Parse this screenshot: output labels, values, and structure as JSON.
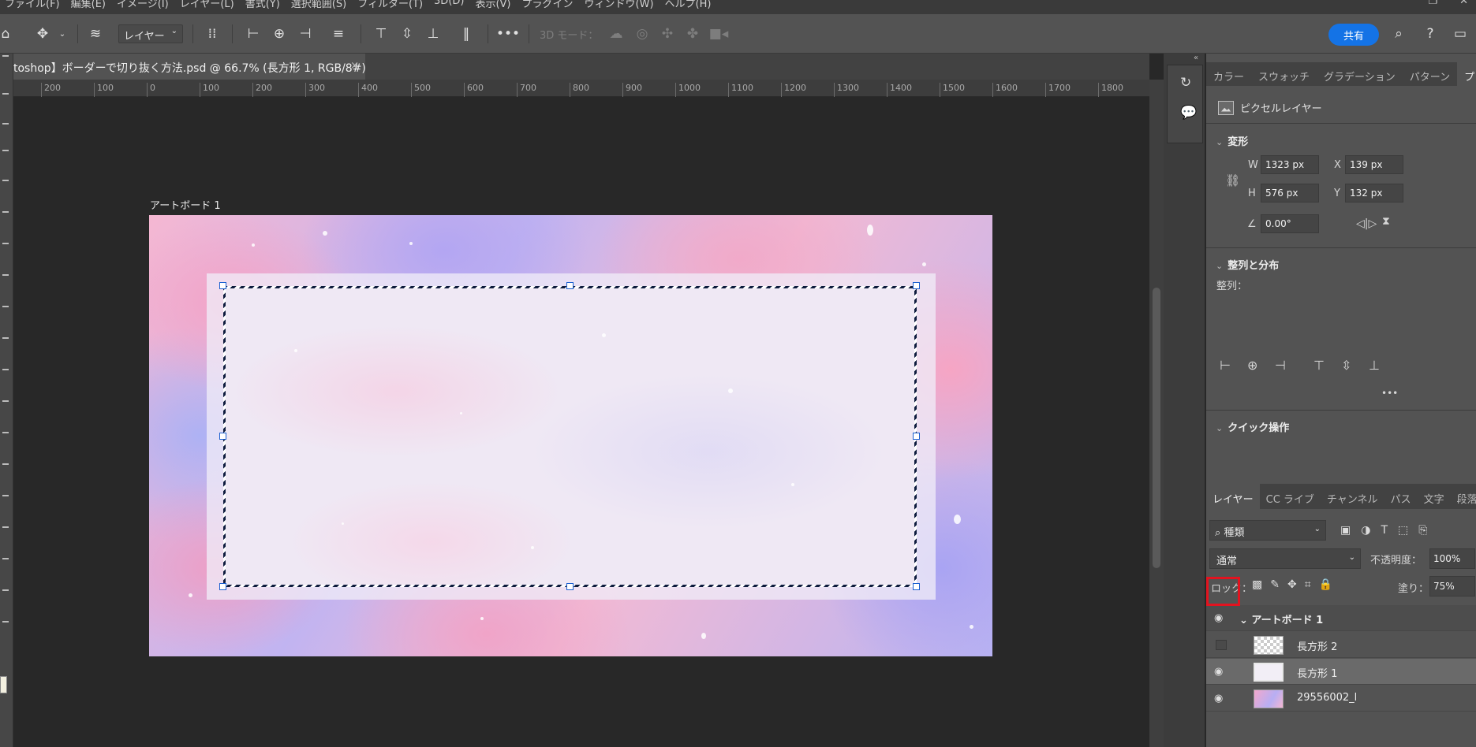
{
  "menubar": {
    "items": [
      "ファイル(F)",
      "編集(E)",
      "イメージ(I)",
      "レイヤー(L)",
      "書式(Y)",
      "選択範囲(S)",
      "フィルター(T)",
      "3D(D)",
      "表示(V)",
      "プラグイン",
      "ウィンドウ(W)",
      "ヘルプ(H)"
    ]
  },
  "optionsbar": {
    "layer_dropdown": "レイヤー",
    "mode3d_label": "3D モード："
  },
  "share_label": "共有",
  "document": {
    "tab_title": "toshop】ボーダーで切り抜く方法.psd @ 66.7% (長方形 1, RGB/8#) *",
    "tab_close": "×",
    "artboard_label": "アートボード 1"
  },
  "ruler": {
    "ticks": [
      "200",
      "100",
      "0",
      "100",
      "200",
      "300",
      "400",
      "500",
      "600",
      "700",
      "800",
      "900",
      "1000",
      "1100",
      "1200",
      "1300",
      "1400",
      "1500",
      "1600",
      "1700",
      "1800"
    ]
  },
  "properties": {
    "tabs": [
      "カラー",
      "スウォッチ",
      "グラデーション",
      "パターン",
      "プロパティ"
    ],
    "active_tab": "プロパティ",
    "layer_kind": "ピクセルレイヤー",
    "transform": {
      "title": "変形",
      "w_label": "W",
      "w_value": "1323 px",
      "x_label": "X",
      "x_value": "139 px",
      "h_label": "H",
      "h_value": "576 px",
      "y_label": "Y",
      "y_value": "132 px",
      "angle_value": "0.00°"
    },
    "align": {
      "title": "整列と分布",
      "sub": "整列：",
      "more": "•••"
    },
    "quick": {
      "title": "クイック操作"
    }
  },
  "layers": {
    "tabs": [
      "レイヤー",
      "CC ライブ",
      "チャンネル",
      "パス",
      "文字",
      "段落"
    ],
    "active_tab": "レイヤー",
    "filter_label": "種類",
    "blend_mode": "通常",
    "opacity_label": "不透明度：",
    "opacity_value": "100%",
    "lock_label": "ロック：",
    "fill_label": "塗り：",
    "fill_value": "75%",
    "items": [
      {
        "name": "アートボード 1",
        "visible": true,
        "group": true
      },
      {
        "name": "長方形 2",
        "visible": false
      },
      {
        "name": "長方形 1",
        "visible": true,
        "selected": true
      },
      {
        "name": "29556002_l",
        "visible": true
      }
    ]
  },
  "colors": {
    "accent": "#1473e6",
    "highlight": "#e3131f"
  }
}
